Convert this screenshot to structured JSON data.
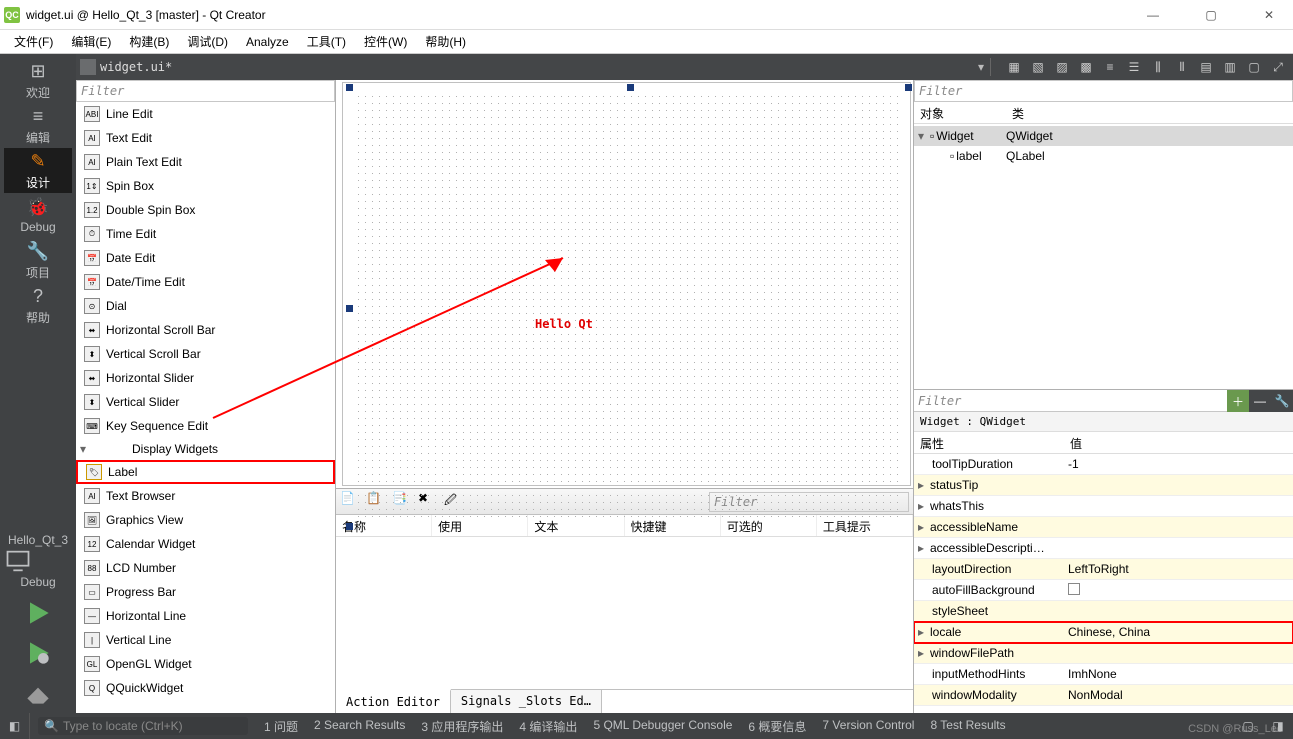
{
  "window": {
    "title": "widget.ui @ Hello_Qt_3 [master] - Qt Creator"
  },
  "menubar": [
    "文件(F)",
    "编辑(E)",
    "构建(B)",
    "调试(D)",
    "Analyze",
    "工具(T)",
    "控件(W)",
    "帮助(H)"
  ],
  "doctab": {
    "name": "widget.ui*"
  },
  "leftmodes": [
    {
      "icon": "⊞",
      "label": "欢迎"
    },
    {
      "icon": "≡",
      "label": "编辑"
    },
    {
      "icon": "✎",
      "label": "设计"
    },
    {
      "icon": "🐞",
      "label": "Debug"
    },
    {
      "icon": "🔧",
      "label": "项目"
    },
    {
      "icon": "?",
      "label": "帮助"
    }
  ],
  "kit": {
    "name": "Hello_Qt_3",
    "config": "Debug"
  },
  "widgetbox": {
    "filter": "Filter",
    "items_before": [
      "Line Edit",
      "Text Edit",
      "Plain Text Edit",
      "Spin Box",
      "Double Spin Box",
      "Time Edit",
      "Date Edit",
      "Date/Time Edit",
      "Dial",
      "Horizontal Scroll Bar",
      "Vertical Scroll Bar",
      "Horizontal Slider",
      "Vertical Slider",
      "Key Sequence Edit"
    ],
    "category": "Display Widgets",
    "highlight_item": "Label",
    "items_after": [
      "Text Browser",
      "Graphics View",
      "Calendar Widget",
      "LCD Number",
      "Progress Bar",
      "Horizontal Line",
      "Vertical Line",
      "OpenGL Widget",
      "QQuickWidget"
    ]
  },
  "canvas_label": "Hello Qt",
  "action_editor": {
    "filter": "Filter",
    "columns": [
      "名称",
      "使用",
      "文本",
      "快捷键",
      "可选的",
      "工具提示"
    ],
    "tabs": [
      "Action Editor",
      "Signals _Slots Ed…"
    ]
  },
  "object_inspector": {
    "filter": "Filter",
    "columns": [
      "对象",
      "类"
    ],
    "rows": [
      {
        "name": "Widget",
        "class": "QWidget",
        "indent": 0,
        "expanded": true,
        "selected": true
      },
      {
        "name": "label",
        "class": "QLabel",
        "indent": 1
      }
    ]
  },
  "property_editor": {
    "filter": "Filter",
    "path": "Widget : QWidget",
    "columns": [
      "属性",
      "值"
    ],
    "rows": [
      {
        "name": "toolTipDuration",
        "value": "-1",
        "yellow": false,
        "indent": true
      },
      {
        "name": "statusTip",
        "value": "",
        "yellow": true,
        "expand": true
      },
      {
        "name": "whatsThis",
        "value": "",
        "yellow": false,
        "expand": true
      },
      {
        "name": "accessibleName",
        "value": "",
        "yellow": true,
        "expand": true
      },
      {
        "name": "accessibleDescripti…",
        "value": "",
        "yellow": false,
        "expand": true
      },
      {
        "name": "layoutDirection",
        "value": "LeftToRight",
        "yellow": true
      },
      {
        "name": "autoFillBackground",
        "value": "checkbox",
        "yellow": false
      },
      {
        "name": "styleSheet",
        "value": "",
        "yellow": true
      },
      {
        "name": "locale",
        "value": "Chinese, China",
        "yellow": true,
        "highlight": true,
        "expand": true
      },
      {
        "name": "windowFilePath",
        "value": "",
        "yellow": true,
        "expand": true
      },
      {
        "name": "inputMethodHints",
        "value": "ImhNone",
        "yellow": false
      },
      {
        "name": "windowModality",
        "value": "NonModal",
        "yellow": true
      }
    ]
  },
  "statusbar": {
    "locate": "Type to locate (Ctrl+K)",
    "tabs": [
      "1 问题",
      "2 Search Results",
      "3 应用程序输出",
      "4 编译输出",
      "5 QML Debugger Console",
      "6 概要信息",
      "7 Version Control",
      "8 Test Results"
    ]
  },
  "watermark": "CSDN @Russ_Leo"
}
